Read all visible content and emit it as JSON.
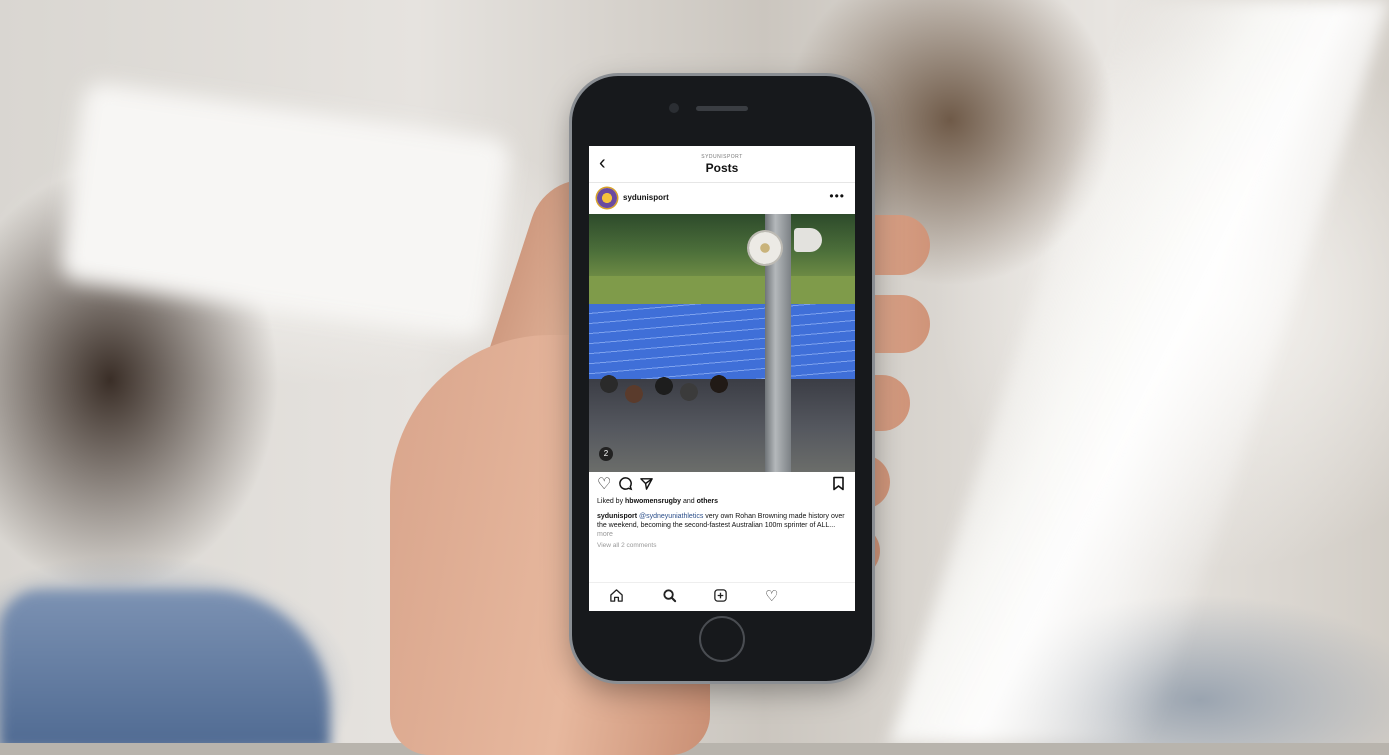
{
  "header": {
    "account_caption": "SYDUNISPORT",
    "title": "Posts",
    "back_icon": "chevron-left-icon"
  },
  "post": {
    "username": "sydunisport",
    "more_icon": "ellipsis-icon",
    "media_indicator": "2",
    "likes": {
      "prefix": "Liked by ",
      "user": "hbwomensrugby",
      "middle": " and ",
      "others": "others"
    },
    "caption": {
      "user": "sydunisport",
      "mention": "@sydneyuniathletics",
      "text": " very own Rohan Browning made history over the weekend, becoming the second-fastest Australian 100m sprinter of ALL...",
      "more": " more"
    },
    "view_comments": "View all 2 comments"
  },
  "actions": {
    "like_icon": "heart-icon",
    "comment_icon": "comment-icon",
    "share_icon": "send-icon",
    "save_icon": "bookmark-icon"
  },
  "bottom_nav": [
    "home-icon",
    "search-icon",
    "add-icon",
    "activity-icon"
  ]
}
